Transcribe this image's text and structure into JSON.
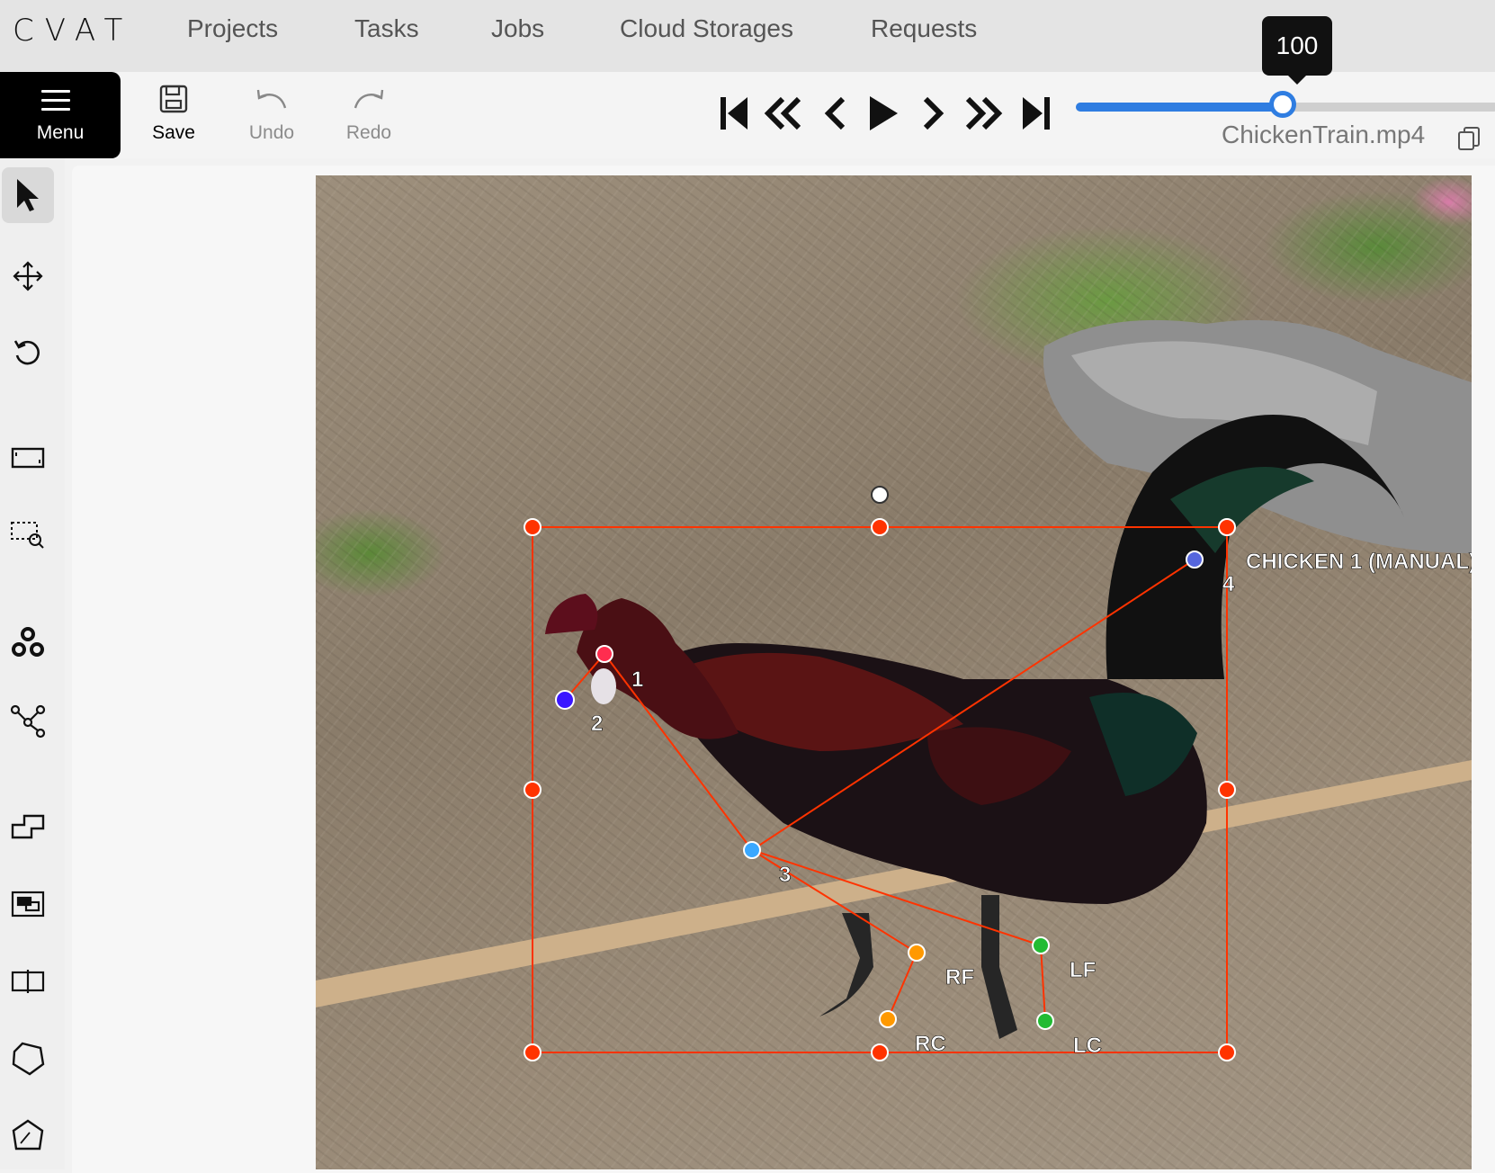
{
  "app": {
    "logo": "CVAT"
  },
  "topnav": {
    "items": [
      {
        "label": "Projects"
      },
      {
        "label": "Tasks"
      },
      {
        "label": "Jobs"
      },
      {
        "label": "Cloud Storages"
      },
      {
        "label": "Requests"
      }
    ]
  },
  "toolbar": {
    "menu_label": "Menu",
    "save_label": "Save",
    "undo_label": "Undo",
    "redo_label": "Redo"
  },
  "player": {
    "frame": "100",
    "progress": 0.49,
    "filename": "ChickenTrain.mp4"
  },
  "sidebar": {
    "tools": [
      "cursor-icon",
      "move-icon",
      "rotate-icon",
      "fit-image-icon",
      "zoom-region-icon",
      "ai-tools-icon",
      "skeleton-icon",
      "merge-icon",
      "group-icon",
      "split-icon",
      "polygon-icon",
      "polyline-icon"
    ]
  },
  "annotation": {
    "label": "CHICKEN 1 (MANUAL)",
    "box_color": "#ff3300",
    "keypoints": [
      {
        "name": "1",
        "color": "#ff2d4f"
      },
      {
        "name": "2",
        "color": "#3a16ff"
      },
      {
        "name": "3",
        "color": "#3aa8ff"
      },
      {
        "name": "4",
        "color": "#5566dd"
      },
      {
        "name": "RF",
        "color": "#ff9900"
      },
      {
        "name": "RC",
        "color": "#ff9900"
      },
      {
        "name": "LF",
        "color": "#22bb33"
      },
      {
        "name": "LC",
        "color": "#22bb33"
      }
    ]
  }
}
